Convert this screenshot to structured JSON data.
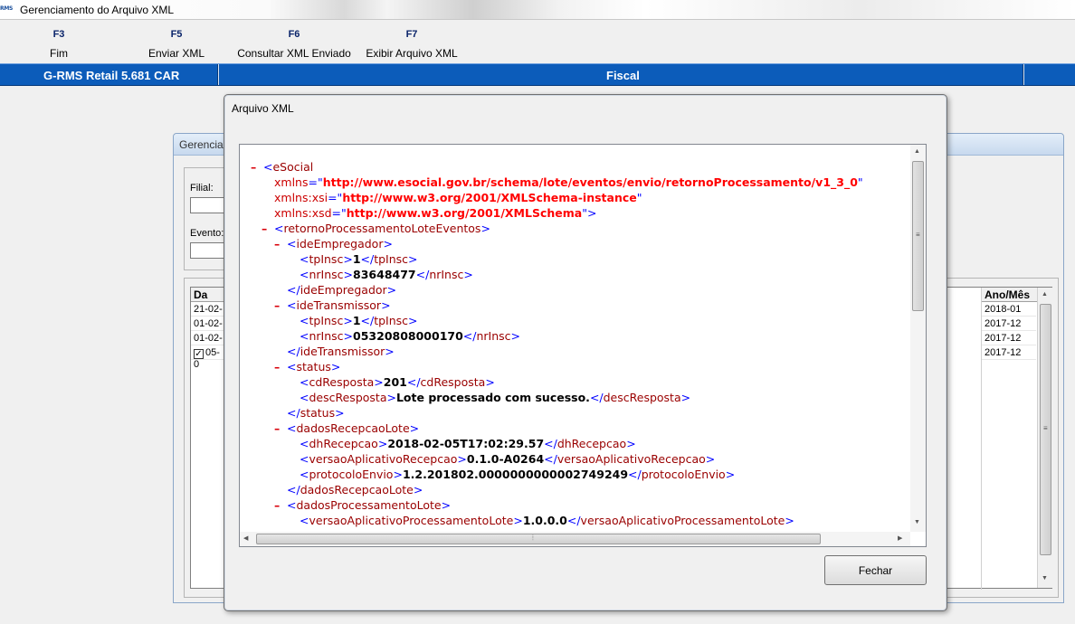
{
  "window": {
    "title": "Gerenciamento do Arquivo XML",
    "logo_text": "RMS"
  },
  "toolbar": [
    {
      "key": "F3",
      "label": "Fim"
    },
    {
      "key": "F5",
      "label": "Enviar XML"
    },
    {
      "key": "F6",
      "label": "Consultar XML Enviado"
    },
    {
      "key": "F7",
      "label": "Exibir Arquivo XML"
    }
  ],
  "statusbar": {
    "product": "G-RMS Retail 5.681 CAR",
    "module": "Fiscal"
  },
  "background_window": {
    "title": "Gerenciar",
    "filial_label": "Filial:",
    "evento_label": "Evento:",
    "grid": {
      "col_first": "Da",
      "col_last": "Ano/Mês",
      "rows": [
        {
          "date": "21-02-",
          "period": "2018-01",
          "checked": false
        },
        {
          "date": "01-02-",
          "period": "2017-12",
          "checked": false
        },
        {
          "date": "01-02-",
          "period": "2017-12",
          "checked": false
        },
        {
          "date": "05-0",
          "period": "2017-12",
          "checked": true
        }
      ]
    }
  },
  "dialog": {
    "title": "Arquivo XML",
    "close_button": "Fechar",
    "xml": {
      "root": "eSocial",
      "attr_xmlns": "xmlns",
      "val_xmlns": "http://www.esocial.gov.br/schema/lote/eventos/envio/retornoProcessamento/v1_3_0",
      "attr_xsi": "xmlns:xsi",
      "val_xsi": "http://www.w3.org/2001/XMLSchema-instance",
      "attr_xsd": "xmlns:xsd",
      "val_xsd": "http://www.w3.org/2001/XMLSchema",
      "retorno": "retornoProcessamentoLoteEventos",
      "ideEmpregador": "ideEmpregador",
      "tpInsc": "tpInsc",
      "nrInsc": "nrInsc",
      "emp_tpInsc": "1",
      "emp_nrInsc": "83648477",
      "ideTransmissor": "ideTransmissor",
      "trans_tpInsc": "1",
      "trans_nrInsc": "05320808000170",
      "status": "status",
      "cdResposta": "cdResposta",
      "cdResposta_val": "201",
      "descResposta": "descResposta",
      "descResposta_val": "Lote processado com sucesso.",
      "dadosRecepcaoLote": "dadosRecepcaoLote",
      "dhRecepcao": "dhRecepcao",
      "dhRecepcao_val": "2018-02-05T17:02:29.57",
      "versaoAplicativoRecepcao": "versaoAplicativoRecepcao",
      "versaoAplicativoRecepcao_val": "0.1.0-A0264",
      "protocoloEnvio": "protocoloEnvio",
      "protocoloEnvio_val": "1.2.201802.0000000000002749249",
      "dadosProcessamentoLote": "dadosProcessamentoLote",
      "versaoAplicativoProcessamentoLote": "versaoAplicativoProcessamentoLote",
      "versaoAplicativoProcessamentoLote_val": "1.0.0.0",
      "collapse_marker": "–"
    }
  }
}
